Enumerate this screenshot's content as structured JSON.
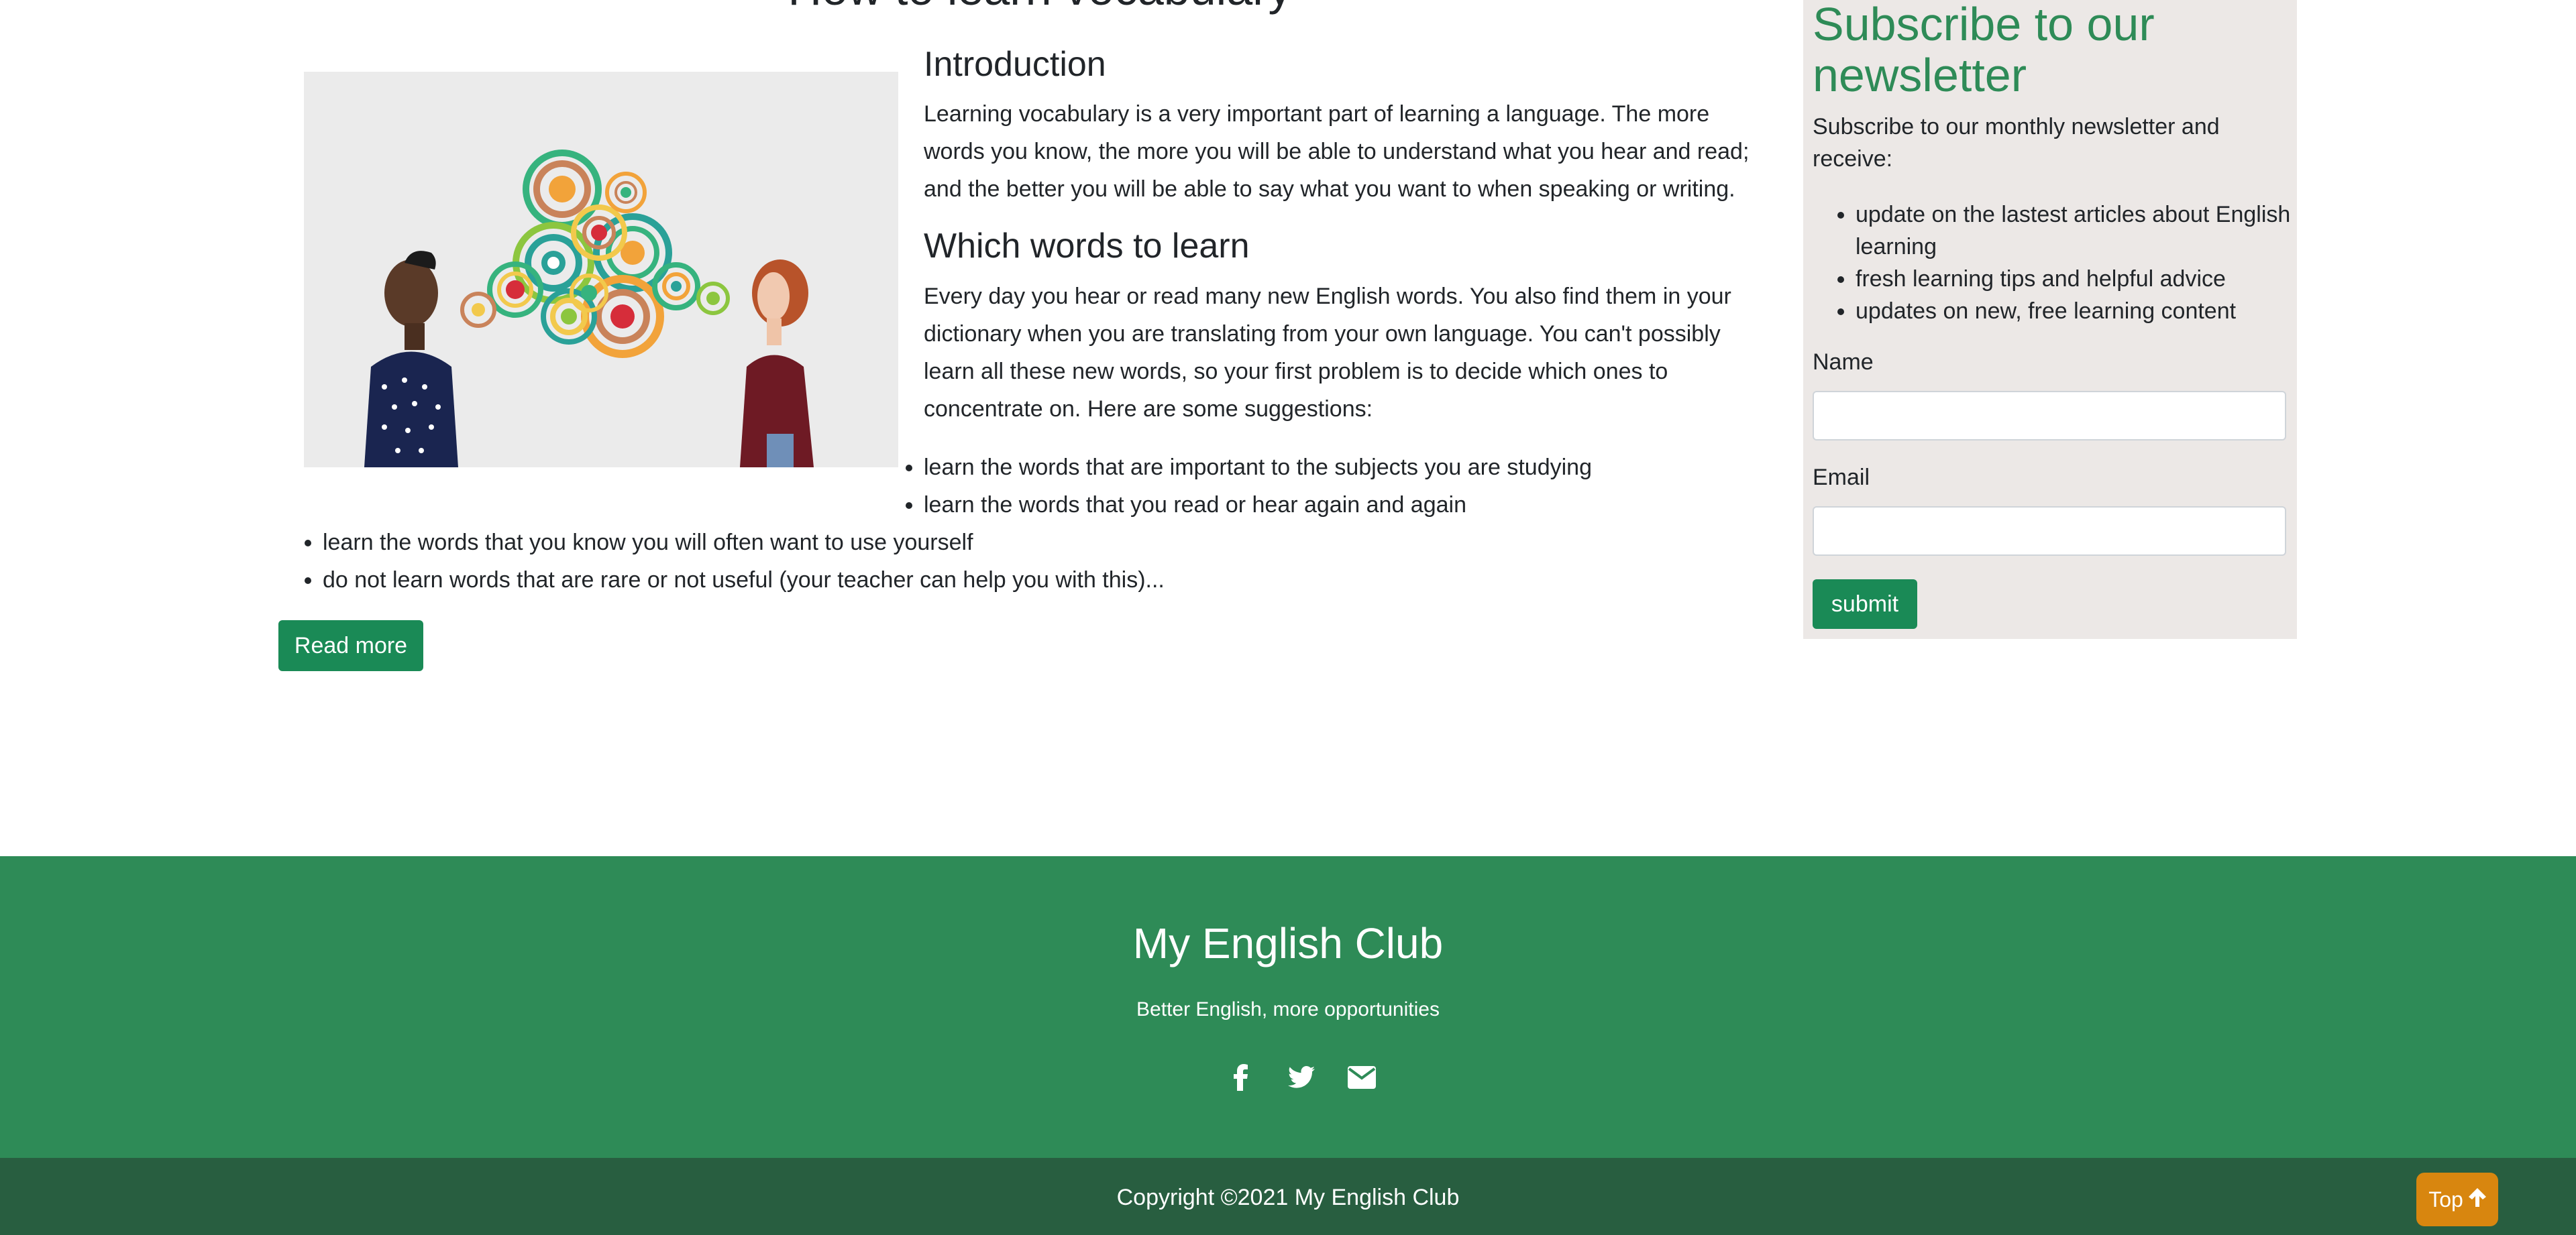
{
  "article": {
    "title": "How to learn vocabulary",
    "hero_image_alt": "Two people talking with colorful concentric circles between them",
    "intro_heading": "Introduction",
    "intro_text": "Learning vocabulary is a very important part of learning a language. The more words you know, the more you will be able to understand what you hear and read; and the better you will be able to say what you want to when speaking or writing.",
    "which_heading": "Which words to learn",
    "which_text": "Every day you hear or read many new English words. You also find them in your dictionary when you are translating from your own language. You can't possibly learn all these new words, so your first problem is to decide which ones to concentrate on. Here are some suggestions:",
    "suggestions": [
      "learn the words that are important to the subjects you are studying",
      "learn the words that you read or hear again and again",
      "learn the words that you know you will often want to use yourself",
      "do not learn words that are rare or not useful (your teacher can help you with this)..."
    ],
    "read_more_label": "Read more"
  },
  "sidebar": {
    "heading": "Subscribe to our newsletter",
    "intro": "Subscribe to our monthly newsletter and receive:",
    "benefits": [
      "update on the lastest articles about English learning",
      "fresh learning tips and helpful advice",
      "updates on new, free learning content"
    ],
    "name_label": "Name",
    "name_value": "",
    "email_label": "Email",
    "email_value": "",
    "submit_label": "submit"
  },
  "footer": {
    "brand": "My English Club",
    "tagline": "Better English, more opportunities",
    "social_icons": [
      "facebook-icon",
      "twitter-icon",
      "envelope-icon"
    ],
    "copyright": "Copyright ©2021 My English Club",
    "top_label": "Top"
  },
  "colors": {
    "brand_green": "#2e8b57",
    "button_green": "#1a8a56",
    "footer_dark": "#285e40",
    "sidebar_bg": "#ece8e6",
    "top_button": "#d8860f"
  }
}
